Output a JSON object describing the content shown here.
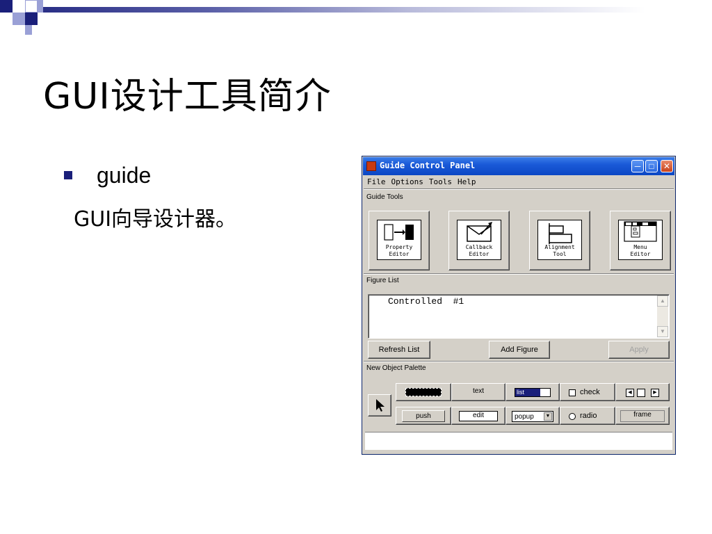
{
  "slide": {
    "title": "GUI设计工具简介",
    "bullet": "guide",
    "subtext": "GUI向导设计器。"
  },
  "window": {
    "title": "Guide Control Panel",
    "menu": [
      "File",
      "Options",
      "Tools",
      "Help"
    ],
    "sections": {
      "tools": "Guide Tools",
      "figures": "Figure List",
      "palette": "New Object Palette"
    },
    "tools": [
      {
        "line1": "Property",
        "line2": "Editor",
        "icon": "property-editor-icon"
      },
      {
        "line1": "Callback",
        "line2": "Editor",
        "icon": "callback-editor-icon"
      },
      {
        "line1": "Alignment",
        "line2": "Tool",
        "icon": "alignment-tool-icon"
      },
      {
        "line1": "Menu",
        "line2": "Editor",
        "icon": "menu-editor-icon"
      }
    ],
    "figure_list": {
      "items": [
        "Controlled  #1"
      ]
    },
    "buttons": {
      "refresh": "Refresh List",
      "add": "Add Figure",
      "apply": "Apply"
    },
    "palette": {
      "text": "text",
      "list": "list",
      "check": "check",
      "push": "push",
      "edit": "edit",
      "popup": "popup",
      "radio": "radio",
      "frame": "frame"
    }
  },
  "colors": {
    "title_bar": "#0b46c4",
    "accent_navy": "#1a1f7a",
    "window_bg": "#d4d0c8"
  }
}
